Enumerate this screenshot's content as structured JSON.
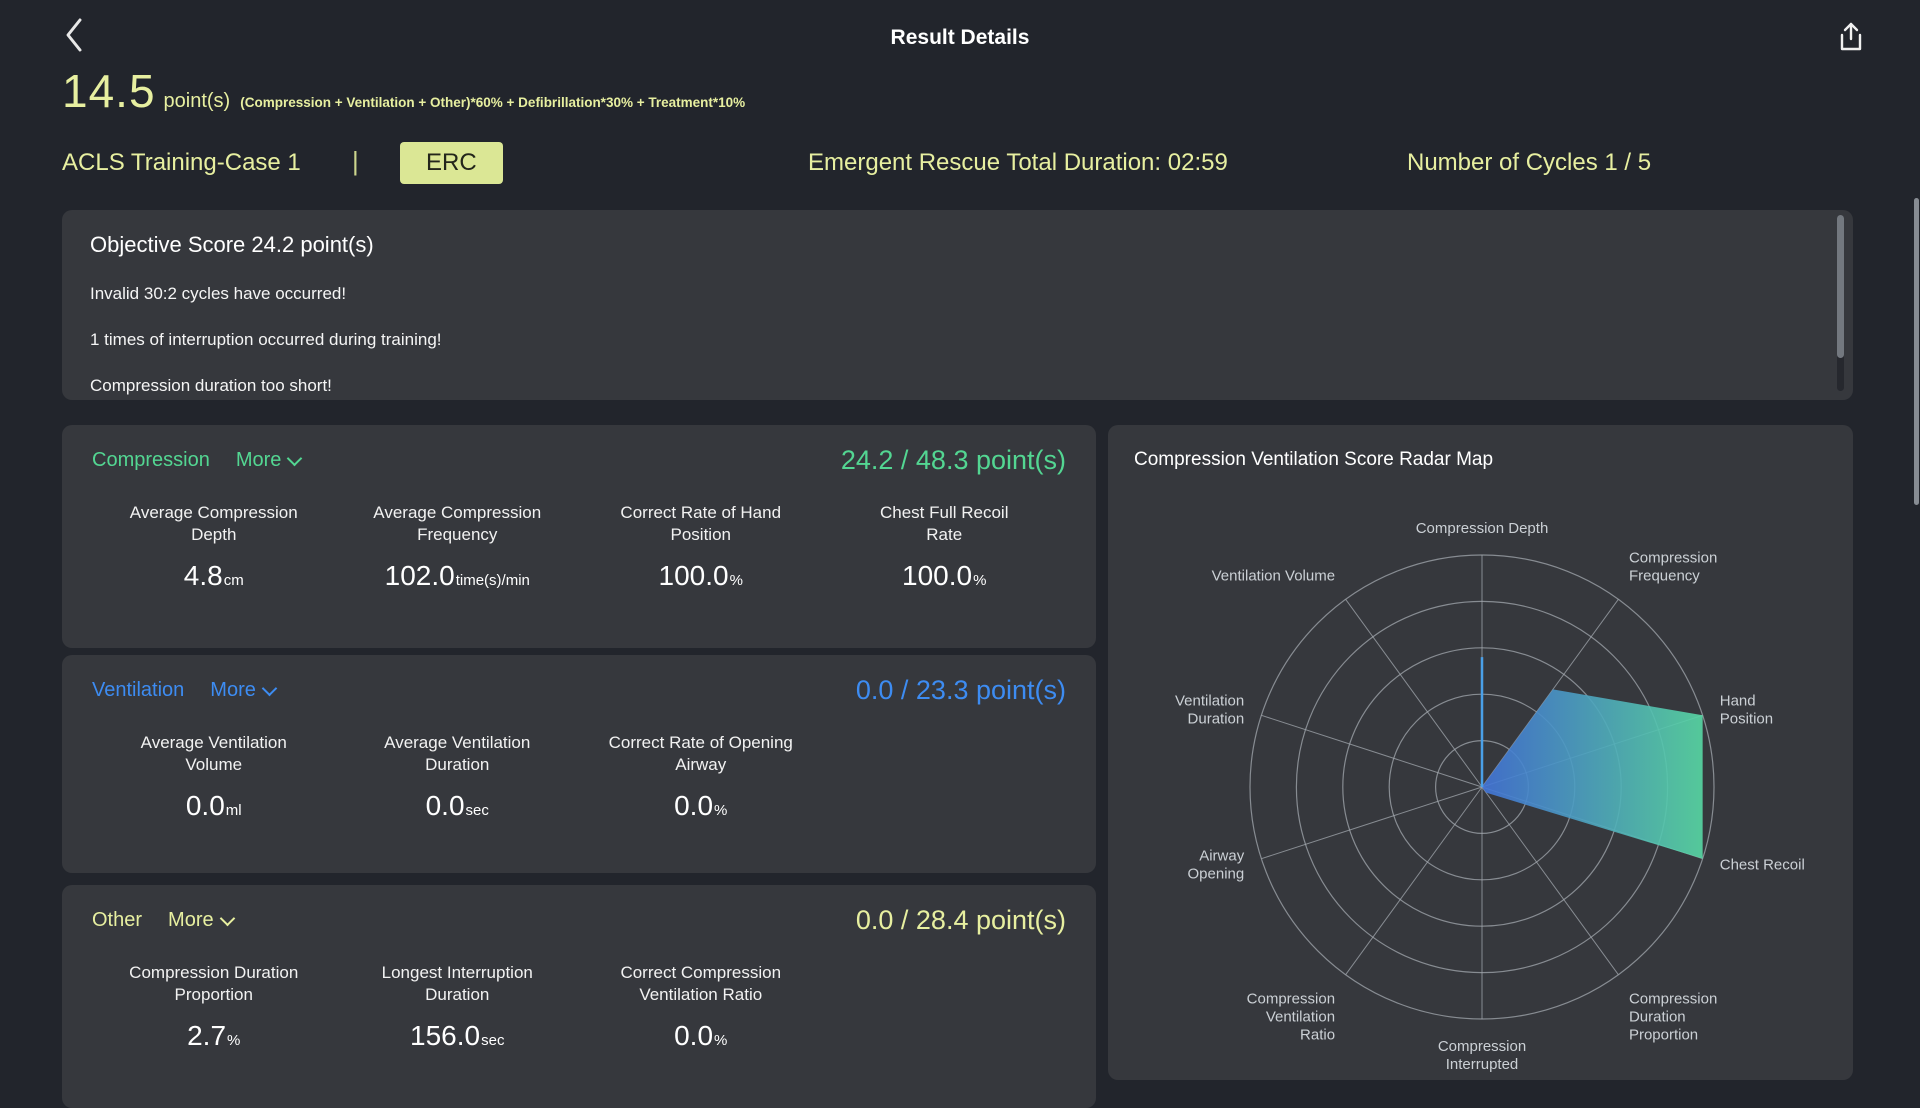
{
  "topbar": {
    "title": "Result Details"
  },
  "score": {
    "value": "14.5",
    "unit": "point(s)",
    "formula": "(Compression + Ventilation + Other)*60% + Defibrillation*30% + Treatment*10%"
  },
  "session": {
    "case_name": "ACLS Training-Case 1",
    "divider": "|",
    "standard_badge": "ERC",
    "duration_label": "Emergent Rescue Total Duration: 02:59",
    "cycles_label": "Number of Cycles 1 / 5"
  },
  "objective": {
    "title": "Objective Score 24.2 point(s)",
    "messages": [
      "Invalid 30:2 cycles have occurred!",
      "1 times of interruption occurred during training!",
      "Compression duration too short!"
    ]
  },
  "panels": [
    {
      "id": "compression",
      "name": "Compression",
      "more_label": "More",
      "score_text": "24.2 / 48.3 point(s)",
      "accent": "#53d692",
      "metrics": [
        {
          "label_lines": [
            "Average Compression",
            "Depth"
          ],
          "value": "4.8",
          "unit": "cm"
        },
        {
          "label_lines": [
            "Average Compression",
            "Frequency"
          ],
          "value": "102.0",
          "unit": "time(s)/min"
        },
        {
          "label_lines": [
            "Correct Rate of Hand",
            "Position"
          ],
          "value": "100.0",
          "unit": "%"
        },
        {
          "label_lines": [
            "Chest Full Recoil",
            "Rate"
          ],
          "value": "100.0",
          "unit": "%"
        }
      ]
    },
    {
      "id": "ventilation",
      "name": "Ventilation",
      "more_label": "More",
      "score_text": "0.0 / 23.3 point(s)",
      "accent": "#3d8cf2",
      "metrics": [
        {
          "label_lines": [
            "Average Ventilation",
            "Volume"
          ],
          "value": "0.0",
          "unit": "ml"
        },
        {
          "label_lines": [
            "Average Ventilation",
            "Duration"
          ],
          "value": "0.0",
          "unit": "sec"
        },
        {
          "label_lines": [
            "Correct Rate of Opening",
            "Airway"
          ],
          "value": "0.0",
          "unit": "%"
        }
      ]
    },
    {
      "id": "other",
      "name": "Other",
      "more_label": "More",
      "score_text": "0.0 / 28.4 point(s)",
      "accent": "#e7efa0",
      "metrics": [
        {
          "label_lines": [
            "Compression Duration",
            "Proportion"
          ],
          "value": "2.7",
          "unit": "%"
        },
        {
          "label_lines": [
            "Longest Interruption",
            "Duration"
          ],
          "value": "156.0",
          "unit": "sec"
        },
        {
          "label_lines": [
            "Correct Compression",
            "Ventilation Ratio"
          ],
          "value": "0.0",
          "unit": "%"
        }
      ]
    }
  ],
  "radar_panel": {
    "title": "Compression Ventilation Score Radar Map"
  },
  "chart_data": {
    "type": "radar",
    "title": "Compression Ventilation Score Radar Map",
    "axes": [
      {
        "lines": [
          "Compression Depth"
        ]
      },
      {
        "lines": [
          "Compression",
          "Frequency"
        ]
      },
      {
        "lines": [
          "Hand",
          "Position"
        ]
      },
      {
        "lines": [
          "Chest Recoil"
        ]
      },
      {
        "lines": [
          "Compression",
          "Duration",
          "Proportion"
        ]
      },
      {
        "lines": [
          "Compression",
          "Interrupted"
        ]
      },
      {
        "lines": [
          "Compression",
          "Ventilation",
          "Ratio"
        ]
      },
      {
        "lines": [
          "Airway",
          "Opening"
        ]
      },
      {
        "lines": [
          "Ventilation",
          "Duration"
        ]
      },
      {
        "lines": [
          "Ventilation Volume"
        ]
      }
    ],
    "values": [
      56,
      52,
      100,
      100,
      3,
      0,
      0,
      0,
      0,
      0
    ],
    "max": 100,
    "rings": 5,
    "area_axes": [
      1,
      2,
      3,
      4
    ],
    "line_axes": [
      0
    ],
    "grid_color": "#a3a8af",
    "label_color": "#cbd0d5",
    "line_color": "#4aa0e8",
    "gradient": [
      "#4273d8",
      "#58d8a4"
    ]
  },
  "colors": {
    "page_bg": "#22252c",
    "panel_bg": "#36383d",
    "accent_yellow": "#e7efa0",
    "accent_green": "#53d692",
    "accent_blue": "#3d8cf2",
    "badge_bg": "#dbe795"
  }
}
